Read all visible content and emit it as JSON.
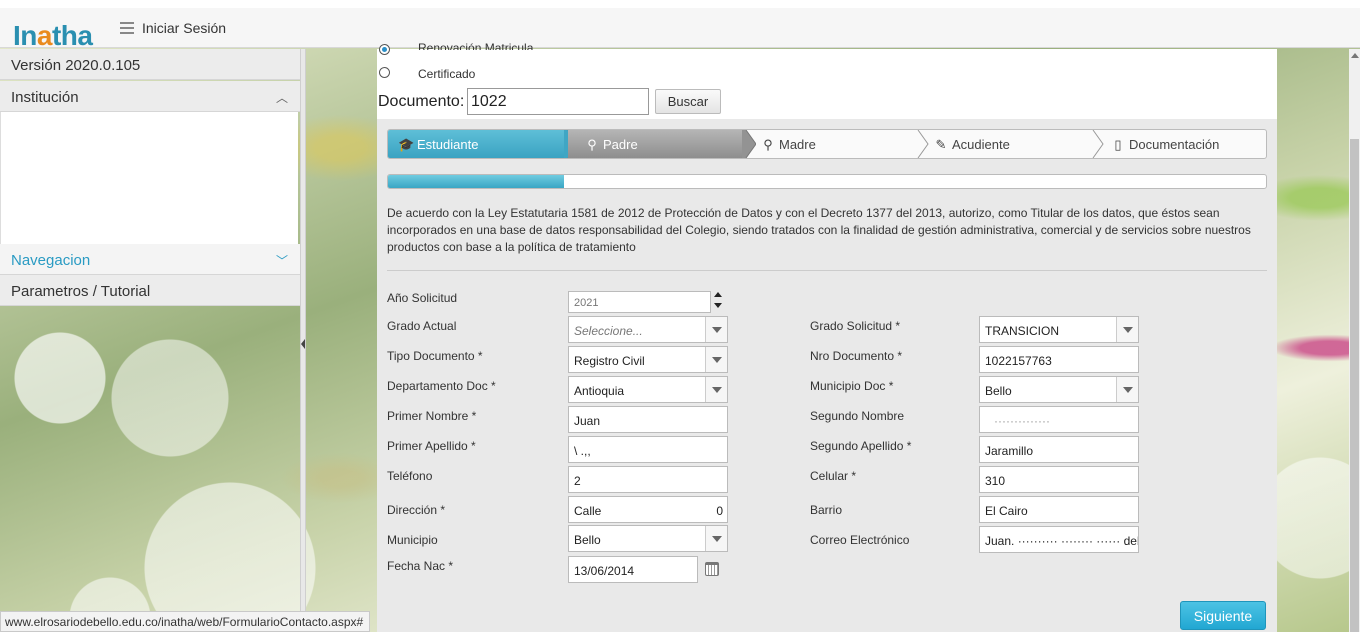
{
  "header": {
    "logo_prefix": "In",
    "logo_accent": "a",
    "logo_suffix": "tha",
    "login_label": "Iniciar Sesión"
  },
  "sidebar": {
    "version": "Versión 2020.0.105",
    "items": [
      {
        "label": "Institución",
        "state": "expanded"
      },
      {
        "label": "Navegacion",
        "state": "collapsed"
      },
      {
        "label": "Parametros / Tutorial"
      }
    ]
  },
  "form_type": {
    "options": [
      {
        "label": "Renovación Matricula",
        "checked": true
      },
      {
        "label": "Certificado",
        "checked": false
      }
    ]
  },
  "search": {
    "label": "Documento:",
    "value": "1022",
    "button": "Buscar"
  },
  "wizard": {
    "steps": [
      {
        "label": "Estudiante",
        "icon": "graduate-icon",
        "state": "active"
      },
      {
        "label": "Padre",
        "icon": "user-icon",
        "state": "visited"
      },
      {
        "label": "Madre",
        "icon": "user-icon",
        "state": "pending"
      },
      {
        "label": "Acudiente",
        "icon": "pencil-icon",
        "state": "pending"
      },
      {
        "label": "Documentación",
        "icon": "document-icon",
        "state": "pending"
      }
    ],
    "progress_fraction": 0.2
  },
  "legal_text": "De acuerdo con la Ley Estatutaria 1581 de 2012 de Protección de Datos y con el Decreto 1377 del 2013, autorizo, como Titular de los datos, que éstos sean incorporados en una base de datos responsabilidad del Colegio, siendo tratados con la finalidad de gestión administrativa, comercial y de servicios sobre nuestros productos con base a la política de tratamiento",
  "form": {
    "anio_solicitud": {
      "label": "Año Solicitud",
      "value": "2021"
    },
    "grado_actual": {
      "label": "Grado Actual",
      "value": "Seleccione..."
    },
    "grado_solicitud": {
      "label": "Grado Solicitud *",
      "value": "TRANSICION"
    },
    "tipo_documento": {
      "label": "Tipo Documento *",
      "value": "Registro Civil"
    },
    "nro_documento": {
      "label": "Nro Documento *",
      "value": "1022157763"
    },
    "departamento_doc": {
      "label": "Departamento Doc *",
      "value": "Antioquia"
    },
    "municipio_doc": {
      "label": "Municipio Doc *",
      "value": "Bello"
    },
    "primer_nombre": {
      "label": "Primer Nombre *",
      "value": "Juan"
    },
    "segundo_nombre": {
      "label": "Segundo Nombre",
      "value": "··············"
    },
    "primer_apellido": {
      "label": "Primer Apellido *",
      "value": "\\ .,,"
    },
    "segundo_apellido": {
      "label": "Segundo Apellido *",
      "value": "Jaramillo"
    },
    "telefono": {
      "label": "Teléfono",
      "value": "2"
    },
    "celular": {
      "label": "Celular *",
      "value": "310"
    },
    "direccion": {
      "label": "Dirección *",
      "value": "Calle",
      "value_tail": "0"
    },
    "barrio": {
      "label": "Barrio",
      "value": "El Cairo"
    },
    "municipio": {
      "label": "Municipio",
      "value": "Bello"
    },
    "correo": {
      "label": "Correo Electrónico",
      "value": "Juan. ·········· ········ ······ debe"
    },
    "fecha_nac": {
      "label": "Fecha Nac *",
      "value": "13/06/2014"
    }
  },
  "next_button": "Siguiente",
  "status_url": "www.elrosariodebello.edu.co/inatha/web/FormularioContacto.aspx#",
  "colors": {
    "accent": "#2a9bc3",
    "logo_orange": "#e98b1e",
    "active_step": "#4bb3cf",
    "button_primary": "#2aabd6"
  }
}
